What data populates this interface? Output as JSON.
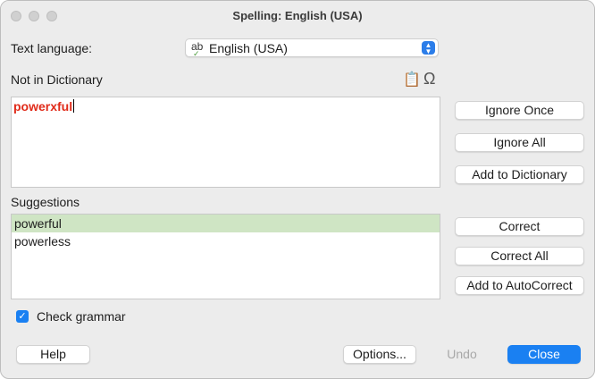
{
  "window": {
    "title": "Spelling: English (USA)"
  },
  "text_language": {
    "label": "Text language:",
    "value": "English (USA)",
    "icon": "spellcheck-icon"
  },
  "not_in_dictionary": {
    "label": "Not in Dictionary",
    "word": "powerxful",
    "tools": {
      "paste_icon": "clipboard-icon",
      "special_char_icon": "omega-icon"
    }
  },
  "suggestions": {
    "label": "Suggestions",
    "items": [
      "powerful",
      "powerless"
    ]
  },
  "buttons": {
    "ignore_once": "Ignore Once",
    "ignore_all": "Ignore All",
    "add_to_dictionary": "Add to Dictionary",
    "correct": "Correct",
    "correct_all": "Correct All",
    "add_to_autocorrect": "Add to AutoCorrect",
    "help": "Help",
    "options": "Options...",
    "undo": "Undo",
    "close": "Close"
  },
  "check_grammar": {
    "label": "Check grammar",
    "checked": true
  },
  "colors": {
    "accent": "#1a80f2",
    "error_word": "#e02b1a",
    "selection": "#cfe5c4"
  }
}
